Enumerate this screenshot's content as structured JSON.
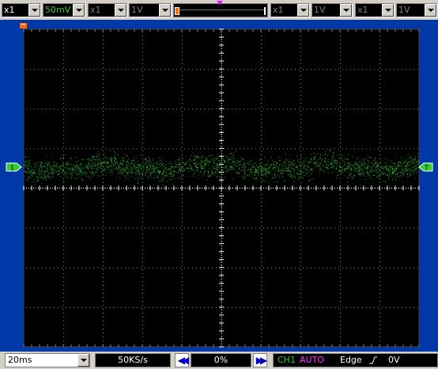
{
  "toolbar": {
    "ch1_probe": "x1",
    "ch1_volts": "50mV",
    "ch2_probe": "x1",
    "ch2_volts": "1V",
    "ch3_probe": "x1",
    "ch3_volts": "1V",
    "ch4_probe": "x1",
    "ch4_volts": "1V"
  },
  "scope": {
    "channel_marker_label": "1",
    "trigger_level_marker_label": "T",
    "trace_color": "#33cc33",
    "grid_color": "#ffffff",
    "background": "#000000",
    "frame_color": "#0038a8",
    "trigger_marker_color": "#ff00ff",
    "ground_marker_color": "#ff6a00"
  },
  "statusbar": {
    "timebase": "20ms",
    "sample_rate": "50KS/s",
    "position": "0%",
    "trigger_channel": "CH1",
    "trigger_mode": "AUTO",
    "trigger_type": "Edge",
    "trigger_slope_icon": "rising-edge-icon",
    "trigger_level": "0V"
  }
}
